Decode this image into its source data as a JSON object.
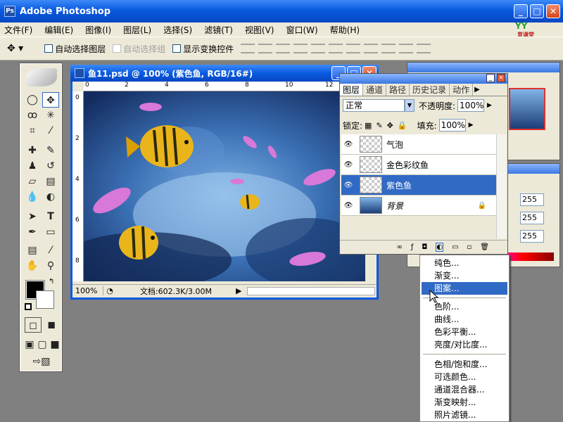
{
  "app": {
    "title": "Adobe Photoshop",
    "logo": "Ps",
    "brand": "育课堂"
  },
  "window_buttons": {
    "min": "_",
    "max": "□",
    "close": "✕"
  },
  "menu": [
    "文件(F)",
    "编辑(E)",
    "图像(I)",
    "图层(L)",
    "选择(S)",
    "滤镜(T)",
    "视图(V)",
    "窗口(W)",
    "帮助(H)"
  ],
  "options": {
    "auto_select_layer": "自动选择图层",
    "auto_select_group": "自动选择组",
    "show_transform": "显示变换控件"
  },
  "document": {
    "title": "鱼11.psd @ 100% (紫色鱼, RGB/16#)",
    "zoom": "100%",
    "doc_info": "文档:602.3K/3.00M",
    "ruler_h": [
      "0",
      "2",
      "4",
      "6",
      "8",
      "10",
      "12"
    ],
    "ruler_v": [
      "0",
      "2",
      "4",
      "6",
      "8"
    ]
  },
  "layers_panel": {
    "tabs": [
      "图层",
      "通道",
      "路径",
      "历史记录",
      "动作"
    ],
    "blend_mode": "正常",
    "opacity_label": "不透明度:",
    "opacity": "100%",
    "lock_label": "锁定:",
    "fill_label": "填充:",
    "fill": "100%",
    "layers": [
      {
        "name": "气泡"
      },
      {
        "name": "金色彩纹鱼"
      },
      {
        "name": "紫色鱼"
      },
      {
        "name": "背景"
      }
    ]
  },
  "color_values": [
    "255",
    "255",
    "255"
  ],
  "context_menu": {
    "items": [
      "纯色...",
      "渐变...",
      "图案...",
      "色阶...",
      "曲线...",
      "色彩平衡...",
      "亮度/对比度...",
      "色相/饱和度...",
      "可选颜色...",
      "通道混合器...",
      "渐变映射...",
      "照片滤镜..."
    ]
  },
  "colors": {
    "xp_blue": "#0a5ae0",
    "selection": "#316ac5",
    "panel_bg": "#ece9d8"
  }
}
